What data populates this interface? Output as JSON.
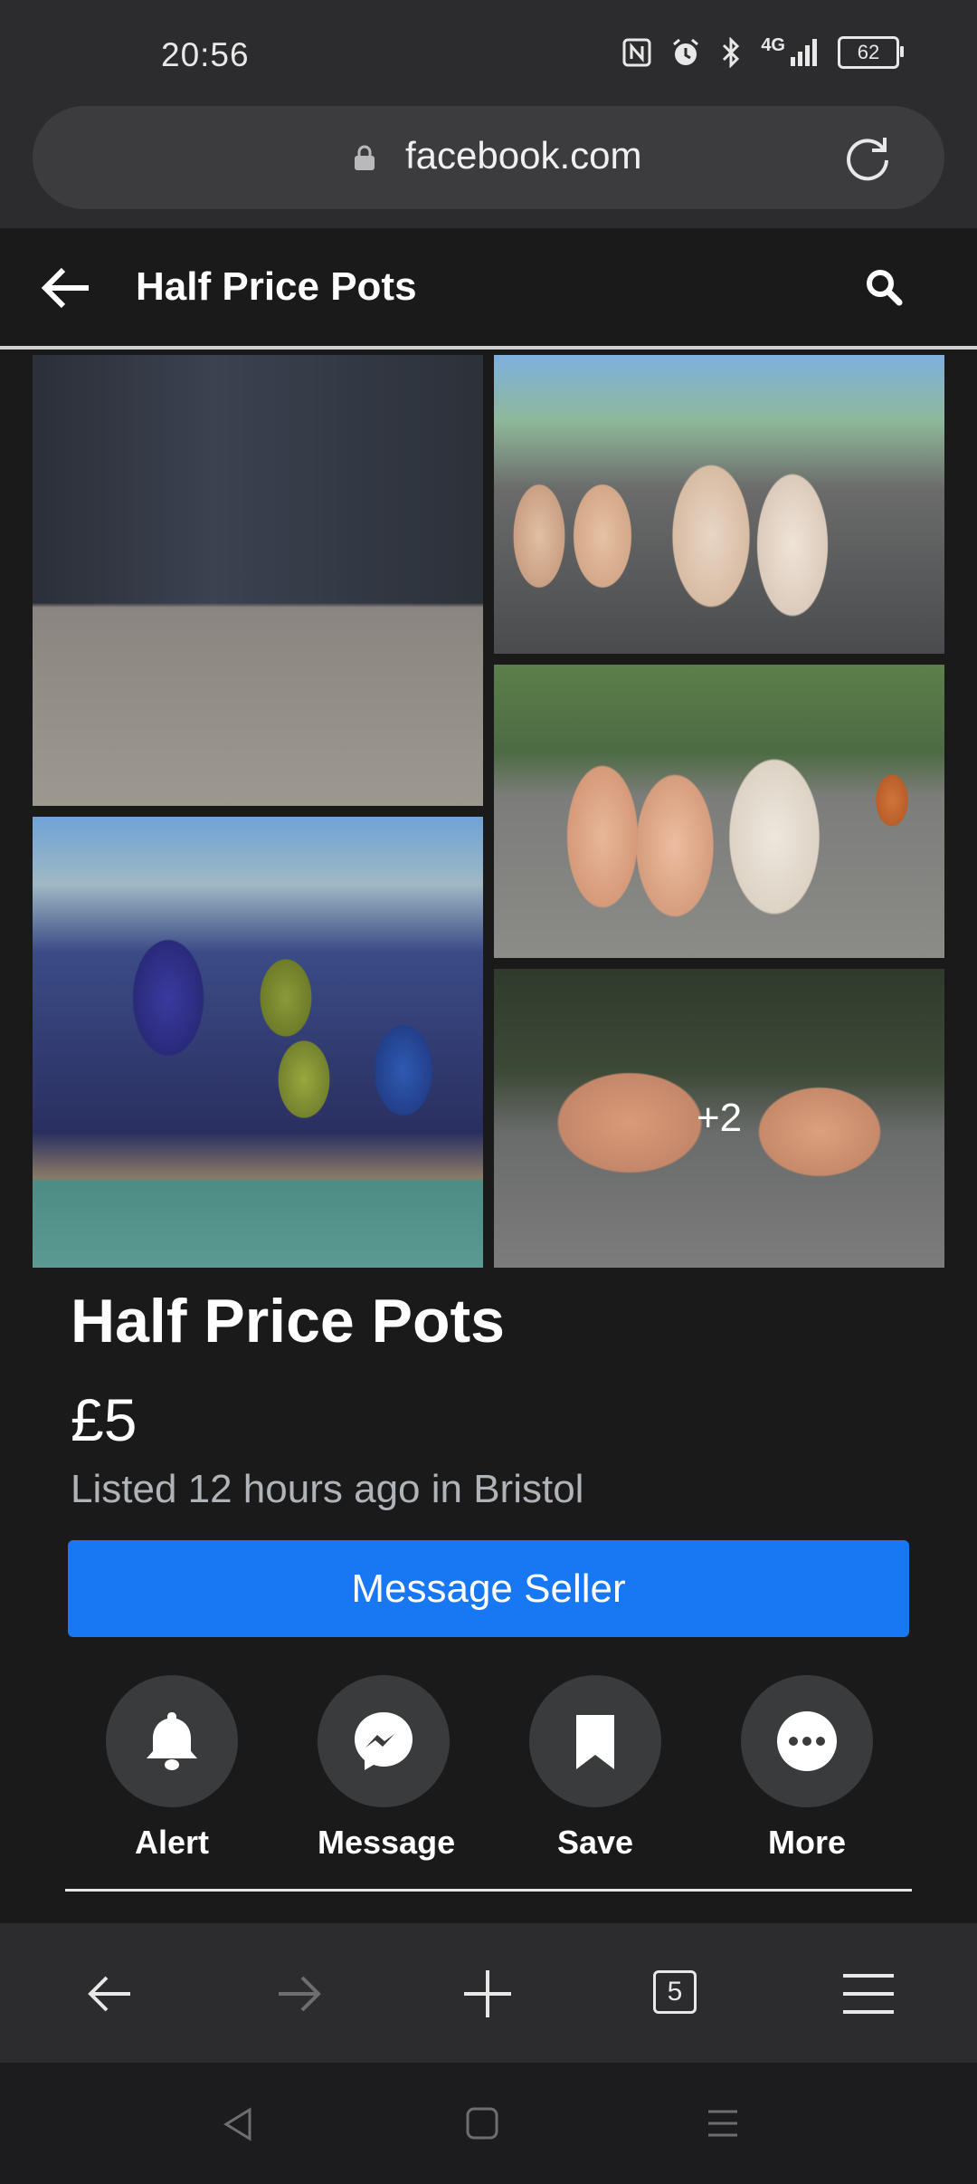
{
  "status_bar": {
    "time": "20:56",
    "network": "4G",
    "battery": "62",
    "icons": [
      "nfc-icon",
      "alarm-icon",
      "bluetooth-icon",
      "signal-icon",
      "battery-icon"
    ]
  },
  "browser": {
    "url": "facebook.com",
    "tab_count": "5"
  },
  "header": {
    "title": "Half Price Pots"
  },
  "gallery": {
    "more_count": "+2"
  },
  "listing": {
    "title": "Half Price Pots",
    "price": "£5",
    "listed": "Listed 12 hours ago in Bristol",
    "cta": "Message Seller"
  },
  "actions": [
    {
      "label": "Alert",
      "icon": "bell-icon"
    },
    {
      "label": "Message",
      "icon": "messenger-icon"
    },
    {
      "label": "Save",
      "icon": "bookmark-icon"
    },
    {
      "label": "More",
      "icon": "more-icon"
    }
  ],
  "colors": {
    "accent": "#1877f2",
    "background": "#1a1a1b",
    "secondary_text": "#b0b3b8"
  }
}
